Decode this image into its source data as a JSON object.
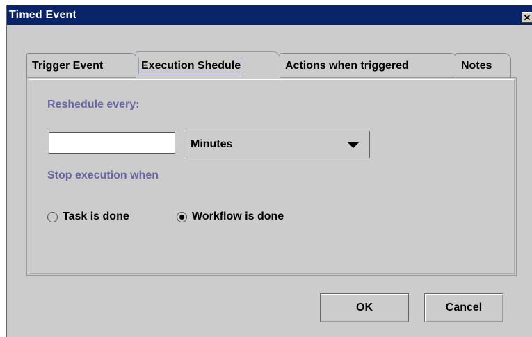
{
  "window": {
    "title": "Timed Event",
    "close_symbol": "✕"
  },
  "tabs": [
    {
      "label": "Trigger Event",
      "selected": false
    },
    {
      "label": "Execution Shedule",
      "selected": true
    },
    {
      "label": "Actions when triggered",
      "selected": false
    },
    {
      "label": "Notes",
      "selected": false
    }
  ],
  "panel": {
    "reschedule_label": "Reshedule every:",
    "interval_value": "",
    "unit_selected": "Minutes",
    "stop_label": "Stop execution when",
    "options": [
      {
        "label": "Task is done",
        "selected": false
      },
      {
        "label": "Workflow is done",
        "selected": true
      }
    ]
  },
  "buttons": {
    "ok": "OK",
    "cancel": "Cancel"
  },
  "colors": {
    "titlebar": "#0a246a",
    "label_blue": "#6666a3",
    "dialog_bg": "#cccccc"
  }
}
